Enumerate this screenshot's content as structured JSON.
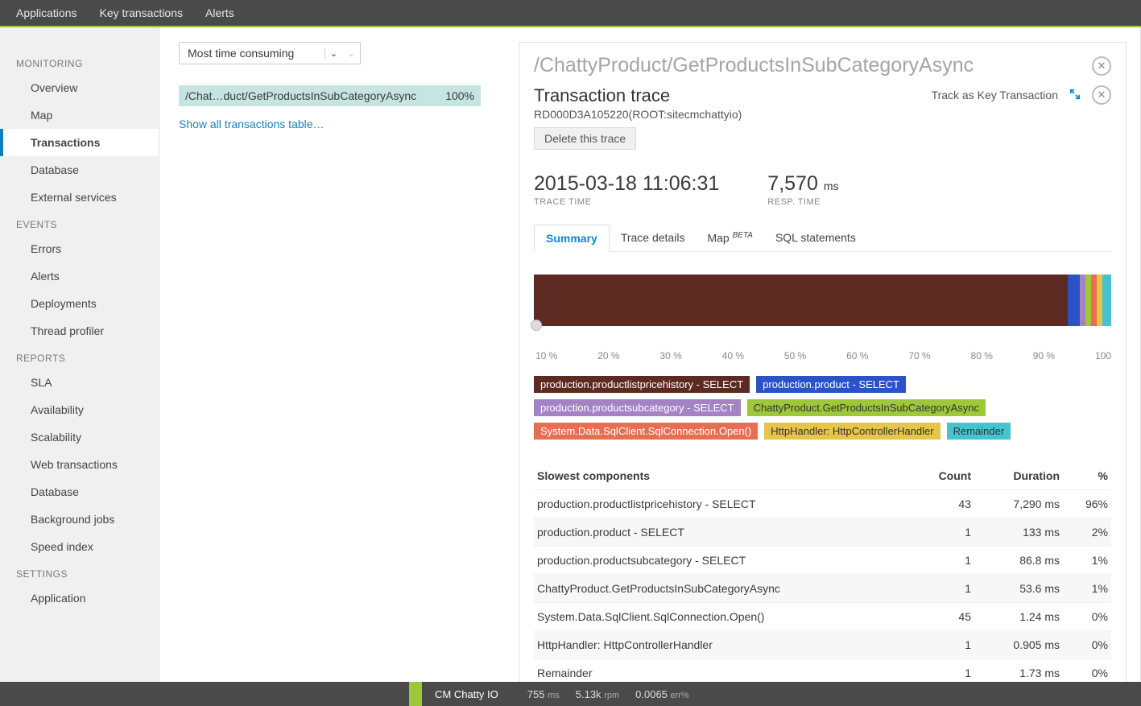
{
  "topnav": [
    "Applications",
    "Key transactions",
    "Alerts"
  ],
  "sidebar": {
    "sections": [
      {
        "label": "MONITORING",
        "items": [
          "Overview",
          "Map",
          "Transactions",
          "Database",
          "External services"
        ],
        "activeIndex": 2
      },
      {
        "label": "EVENTS",
        "items": [
          "Errors",
          "Alerts",
          "Deployments",
          "Thread profiler"
        ]
      },
      {
        "label": "REPORTS",
        "items": [
          "SLA",
          "Availability",
          "Scalability",
          "Web transactions",
          "Database",
          "Background jobs",
          "Speed index"
        ]
      },
      {
        "label": "SETTINGS",
        "items": [
          "Application"
        ]
      }
    ]
  },
  "content": {
    "selector": "Most time consuming",
    "transaction_row": {
      "name": "/Chat…duct/GetProductsInSubCategoryAsync",
      "pct": "100%"
    },
    "show_all": "Show all transactions table…"
  },
  "panel": {
    "title": "/ChattyProduct/GetProductsInSubCategoryAsync",
    "subtitle": "Transaction trace",
    "track_label": "Track as Key Transaction",
    "root": "RD000D3A105220(ROOT:sitecmchattyio)",
    "delete_label": "Delete this trace",
    "metrics": {
      "time": "2015-03-18 11:06:31",
      "time_label": "TRACE TIME",
      "resp": "7,570",
      "resp_unit": "ms",
      "resp_label": "RESP. TIME"
    },
    "tabs": [
      "Summary",
      "Trace details",
      "Map",
      "SQL statements"
    ],
    "tab_beta": "BETA"
  },
  "chart_data": {
    "type": "bar",
    "orientation": "horizontal-stacked",
    "xlabel": "",
    "ylabel": "",
    "xticks": [
      "10 %",
      "20 %",
      "30 %",
      "40 %",
      "50 %",
      "60 %",
      "70 %",
      "80 %",
      "90 %",
      "100"
    ],
    "series": [
      {
        "name": "production.productlistpricehistory - SELECT",
        "pct": 92.5,
        "color": "#5c2a21"
      },
      {
        "name": "production.product - SELECT",
        "pct": 2,
        "color": "#2b52c7"
      },
      {
        "name": "production.productsubcategory - SELECT",
        "pct": 1,
        "color": "#a482c4"
      },
      {
        "name": "ChattyProduct.GetProductsInSubCategoryAsync",
        "pct": 1,
        "color": "#9fc73a"
      },
      {
        "name": "System.Data.SqlClient.SqlConnection.Open()",
        "pct": 1,
        "color": "#e76f51"
      },
      {
        "name": "HttpHandler: HttpControllerHandler",
        "pct": 1,
        "color": "#e6c54a"
      },
      {
        "name": "Remainder",
        "pct": 1.5,
        "color": "#46c3d1"
      }
    ]
  },
  "legend": [
    {
      "text": "production.productlistpricehistory - SELECT",
      "color": "#5c2a21"
    },
    {
      "text": "production.product - SELECT",
      "color": "#2b52c7"
    },
    {
      "text": "production.productsubcategory - SELECT",
      "color": "#a482c4"
    },
    {
      "text": "ChattyProduct.GetProductsInSubCategoryAsync",
      "color": "#9fc73a",
      "dark": true
    },
    {
      "text": "System.Data.SqlClient.SqlConnection.Open()",
      "color": "#e76f51"
    },
    {
      "text": "HttpHandler: HttpControllerHandler",
      "color": "#e6c54a",
      "dark": true
    },
    {
      "text": "Remainder",
      "color": "#46c3d1",
      "dark": true
    }
  ],
  "table": {
    "title": "Slowest components",
    "cols": [
      "Count",
      "Duration",
      "%"
    ],
    "rows": [
      {
        "name": "production.productlistpricehistory - SELECT",
        "count": "43",
        "dur": "7,290 ms",
        "pct": "96%"
      },
      {
        "name": "production.product - SELECT",
        "count": "1",
        "dur": "133 ms",
        "pct": "2%"
      },
      {
        "name": "production.productsubcategory - SELECT",
        "count": "1",
        "dur": "86.8 ms",
        "pct": "1%"
      },
      {
        "name": "ChattyProduct.GetProductsInSubCategoryAsync",
        "count": "1",
        "dur": "53.6 ms",
        "pct": "1%"
      },
      {
        "name": "System.Data.SqlClient.SqlConnection.Open()",
        "count": "45",
        "dur": "1.24 ms",
        "pct": "0%"
      },
      {
        "name": "HttpHandler: HttpControllerHandler",
        "count": "1",
        "dur": "0.905 ms",
        "pct": "0%"
      },
      {
        "name": "Remainder",
        "count": "1",
        "dur": "1.73 ms",
        "pct": "0%"
      }
    ]
  },
  "footer": {
    "app": "CM Chatty IO",
    "stats": [
      {
        "v": "755",
        "u": "ms"
      },
      {
        "v": "5.13k",
        "u": "rpm"
      },
      {
        "v": "0.0065",
        "u": "err%"
      }
    ]
  }
}
